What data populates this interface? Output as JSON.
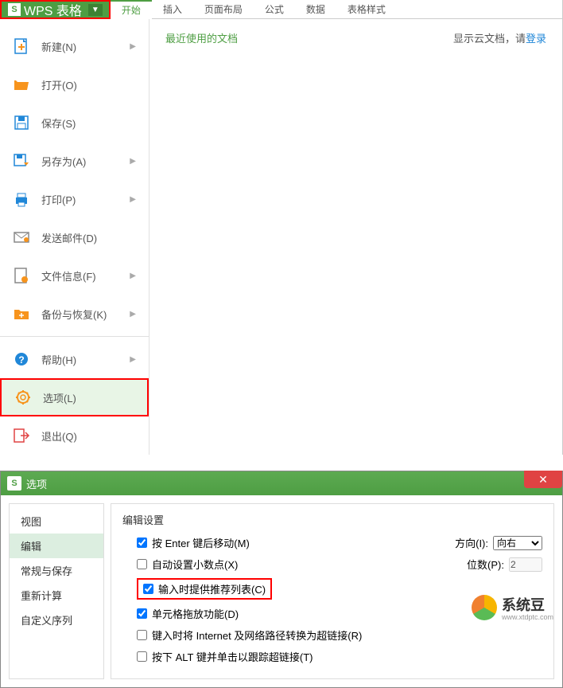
{
  "app": {
    "title": "WPS 表格",
    "tabs": [
      "开始",
      "插入",
      "页面布局",
      "公式",
      "数据",
      "表格样式"
    ],
    "active_tab_index": 0
  },
  "file_menu": {
    "items": [
      {
        "label": "新建(N)",
        "has_arrow": true
      },
      {
        "label": "打开(O)",
        "has_arrow": false
      },
      {
        "label": "保存(S)",
        "has_arrow": false
      },
      {
        "label": "另存为(A)",
        "has_arrow": true
      },
      {
        "label": "打印(P)",
        "has_arrow": true
      },
      {
        "label": "发送邮件(D)",
        "has_arrow": false
      },
      {
        "label": "文件信息(F)",
        "has_arrow": true
      },
      {
        "label": "备份与恢复(K)",
        "has_arrow": true
      },
      {
        "label": "帮助(H)",
        "has_arrow": true
      },
      {
        "label": "选项(L)",
        "has_arrow": false
      },
      {
        "label": "退出(Q)",
        "has_arrow": false
      }
    ],
    "recent_docs_title": "最近使用的文档",
    "cloud_text_prefix": "显示云文档，请",
    "cloud_login": "登录"
  },
  "options_dialog": {
    "title": "选项",
    "sidebar_items": [
      "视图",
      "编辑",
      "常规与保存",
      "重新计算",
      "自定义序列"
    ],
    "selected_sidebar_index": 1,
    "settings_title": "编辑设置",
    "direction_label": "方向(I):",
    "direction_value": "向右",
    "places_label": "位数(P):",
    "places_value": "2",
    "checkboxes": [
      {
        "label": "按 Enter 键后移动(M)",
        "checked": true
      },
      {
        "label": "自动设置小数点(X)",
        "checked": false
      },
      {
        "label": "输入时提供推荐列表(C)",
        "checked": true
      },
      {
        "label": "单元格拖放功能(D)",
        "checked": true
      },
      {
        "label": "键入时将 Internet 及网络路径转换为超链接(R)",
        "checked": false
      },
      {
        "label": "按下 ALT 键并单击以跟踪超链接(T)",
        "checked": false
      }
    ]
  },
  "watermark": {
    "brand": "系统豆",
    "sub": "www.xtdptc.com"
  }
}
